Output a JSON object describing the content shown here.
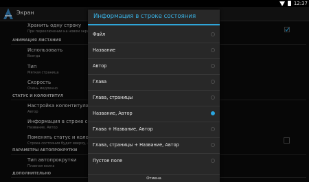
{
  "status_bar": {
    "time": "12:37"
  },
  "app": {
    "title": "Экран"
  },
  "settings": {
    "keep_line": {
      "title": "Хранить одну строку",
      "sub": "При переключении на новом экране"
    },
    "animation_header": "АНИМАЦИЯ ЛИСТАНИЯ",
    "use": {
      "title": "Использовать",
      "sub": "Всегда"
    },
    "type": {
      "title": "Тип",
      "sub": "Мягкая страница"
    },
    "speed": {
      "title": "Скорость",
      "sub": "Очень медленно"
    },
    "status_header": "СТАТУС И КОЛОНТИТУЛ",
    "footer_setup": {
      "title": "Настройка колонтитула",
      "sub": "Автор"
    },
    "status_info": {
      "title": "Информация в строке состояния",
      "sub": "Название, Автор"
    },
    "swap": {
      "title": "Поменять статус и колонтитул",
      "sub": "Строка состояния будет вверху, а колонтитул"
    },
    "autoscroll_header": "ПАРАМЕТРЫ АВТОПРОКРУТКИ",
    "autoscroll_type": {
      "title": "Тип автопрокрутки",
      "sub": "Плавная волна"
    },
    "extra_header": "ДОПОЛНИТЕЛЬНО"
  },
  "dialog": {
    "title": "Информация в строке состояния",
    "options": [
      "Файл",
      "Название",
      "Автор",
      "Глава",
      "Глава, страницы",
      "Название, Автор",
      "Глава + Название, Автор",
      "Глава, страницы + Название, Автор",
      "Пустое поле"
    ],
    "selected_index": 5,
    "cancel": "Отмена"
  },
  "colors": {
    "accent": "#2aa6e0",
    "dialog_bg": "#282828",
    "bg": "#0c0c0c"
  }
}
